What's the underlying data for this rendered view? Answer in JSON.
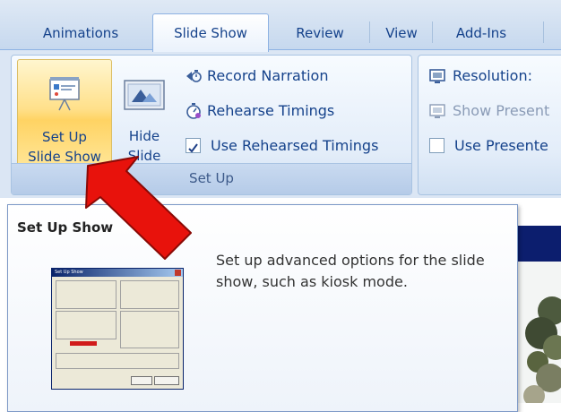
{
  "tabs": [
    {
      "label": "Animations",
      "active": false
    },
    {
      "label": "Slide Show",
      "active": true
    },
    {
      "label": "Review",
      "active": false
    },
    {
      "label": "View",
      "active": false
    },
    {
      "label": "Add-Ins",
      "active": false
    }
  ],
  "ribbon": {
    "setup_group": {
      "label": "Set Up",
      "set_up_slide_show": {
        "line1": "Set Up",
        "line2": "Slide Show"
      },
      "hide_slide": {
        "line1": "Hide",
        "line2": "Slide"
      },
      "record_narration": "Record Narration",
      "rehearse_timings": "Rehearse Timings",
      "use_rehearsed_timings": "Use Rehearsed Timings",
      "use_rehearsed_timings_checked": true
    },
    "monitors_group": {
      "resolution": "Resolution:",
      "show_presentation_on": "Show Present",
      "use_presenter_view": "Use Presente"
    }
  },
  "tooltip": {
    "title": "Set Up Show",
    "body": "Set up advanced options for the slide show, such as kiosk mode.",
    "dialog_title": "Set Up Show"
  },
  "colors": {
    "accent": "#15428b",
    "hover": "#ffd363",
    "arrow": "#e8120c",
    "slide_bg": "#0c1e6e"
  }
}
